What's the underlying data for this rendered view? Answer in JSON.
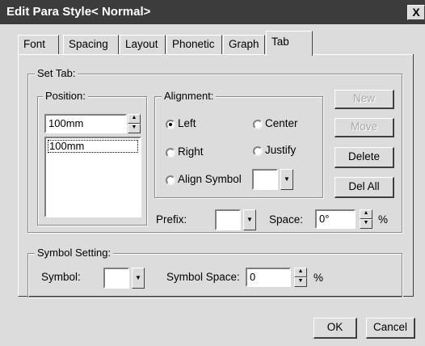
{
  "window": {
    "title": "Edit Para Style< Normal>",
    "close_label": "X"
  },
  "tabs": [
    {
      "label": "Font"
    },
    {
      "label": "Spacing"
    },
    {
      "label": "Layout"
    },
    {
      "label": "Phonetic"
    },
    {
      "label": "Graph"
    },
    {
      "label": "Tab"
    }
  ],
  "set_tab": {
    "label": "Set Tab:",
    "position": {
      "label": "Position:",
      "value": "100mm",
      "list": [
        "100mm"
      ]
    },
    "alignment": {
      "label": "Alignment:",
      "options": [
        "Left",
        "Center",
        "Right",
        "Justify",
        "Align Symbol"
      ],
      "selected": "Left"
    },
    "prefix_label": "Prefix:",
    "space_label": "Space:",
    "space_value": "0°",
    "space_unit": "%"
  },
  "buttons": {
    "new": "New",
    "move": "Move",
    "delete": "Delete",
    "del_all": "Del All",
    "ok": "OK",
    "cancel": "Cancel"
  },
  "symbol_setting": {
    "label": "Symbol Setting:",
    "symbol_label": "Symbol:",
    "symbol_space_label": "Symbol Space:",
    "symbol_space_value": "0",
    "unit": "%"
  }
}
